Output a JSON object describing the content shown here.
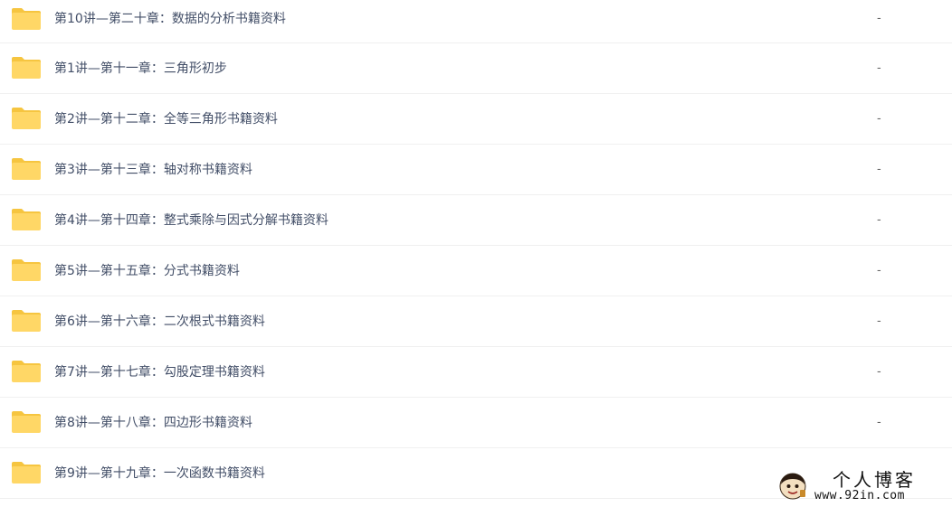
{
  "files": [
    {
      "name": "第10讲—第二十章：数据的分析书籍资料",
      "size": "-"
    },
    {
      "name": "第1讲—第十一章：三角形初步",
      "size": "-"
    },
    {
      "name": "第2讲—第十二章：全等三角形书籍资料",
      "size": "-"
    },
    {
      "name": "第3讲—第十三章：轴对称书籍资料",
      "size": "-"
    },
    {
      "name": "第4讲—第十四章：整式乘除与因式分解书籍资料",
      "size": "-"
    },
    {
      "name": "第5讲—第十五章：分式书籍资料",
      "size": "-"
    },
    {
      "name": "第6讲—第十六章：二次根式书籍资料",
      "size": "-"
    },
    {
      "name": "第7讲—第十七章：勾股定理书籍资料",
      "size": "-"
    },
    {
      "name": "第8讲—第十八章：四边形书籍资料",
      "size": "-"
    },
    {
      "name": "第9讲—第十九章：一次函数书籍资料",
      "size": "-"
    }
  ],
  "icons": {
    "folder": "folder-icon",
    "folder_color": "#ffd766",
    "folder_tab_color": "#f6c540"
  },
  "watermark": {
    "title": "个人博客",
    "url": "www.92in.com"
  }
}
